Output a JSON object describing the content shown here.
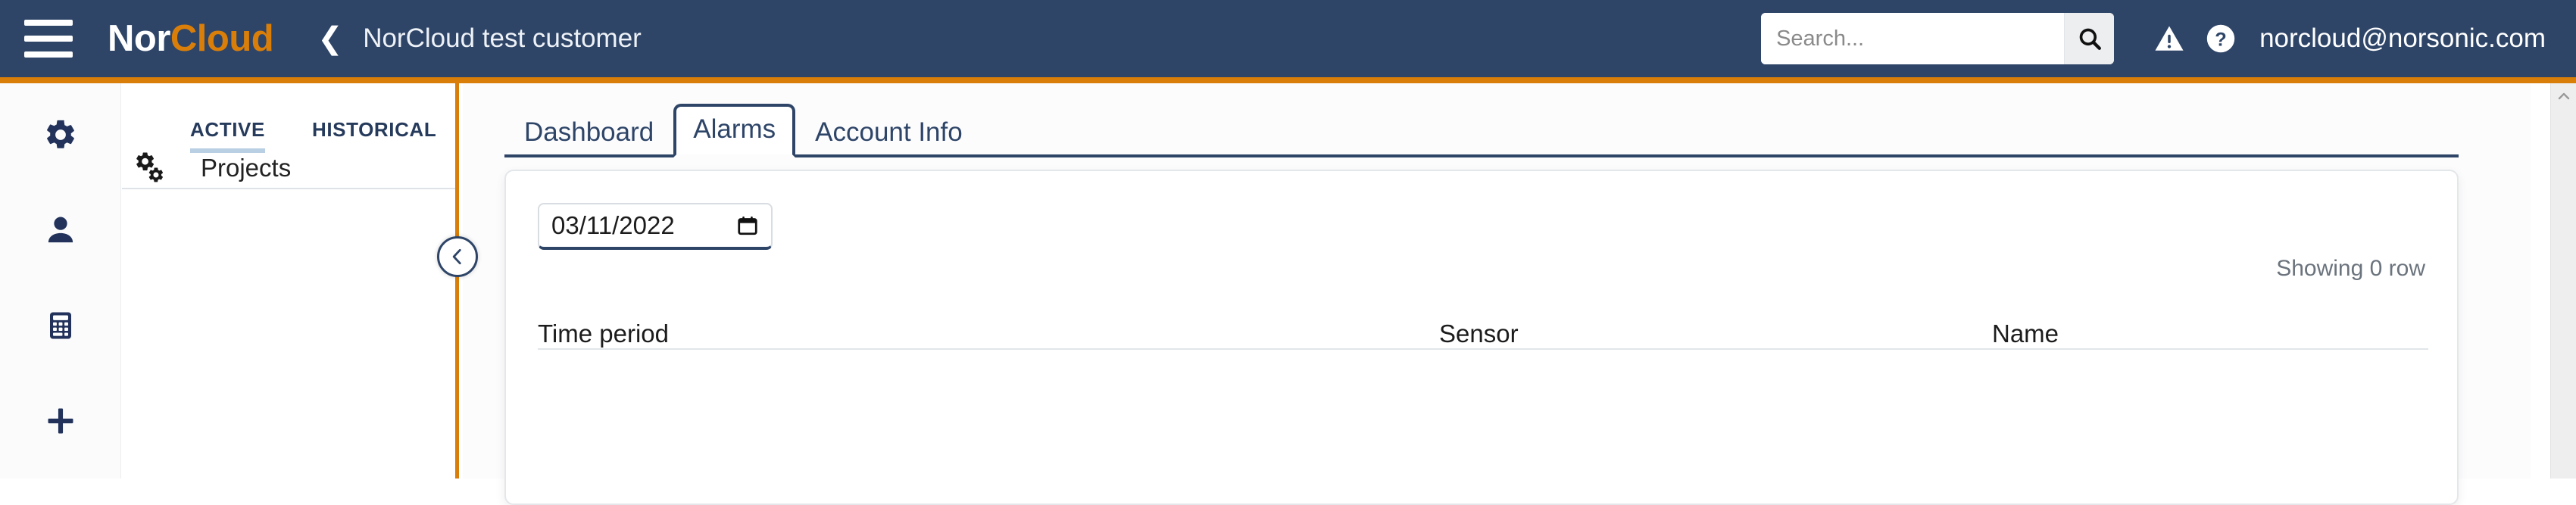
{
  "header": {
    "hamburger_icon": "hamburger-menu-icon",
    "brand_nor": "Nor",
    "brand_cloud": "Cloud",
    "back_icon": "chevron-left-icon",
    "breadcrumb_title": "NorCloud test customer",
    "search_placeholder": "Search...",
    "search_value": "",
    "search_icon": "search-icon",
    "warning_icon": "warning-triangle-icon",
    "help_icon": "question-circle-icon",
    "user_email": "norcloud@norsonic.com",
    "background_color": "#2e4568",
    "accent_color": "#d97e09"
  },
  "rail": {
    "items": [
      {
        "name": "settings",
        "icon": "gear-icon"
      },
      {
        "name": "users",
        "icon": "person-icon"
      },
      {
        "name": "calculator",
        "icon": "calculator-icon"
      },
      {
        "name": "add",
        "icon": "plus-icon"
      }
    ]
  },
  "projects_panel": {
    "tabs": [
      {
        "label": "ACTIVE",
        "active": true
      },
      {
        "label": "HISTORICAL",
        "active": false
      }
    ],
    "group_icon": "cogs-icon",
    "group_label": "Projects",
    "collapse_icon": "chevron-left-icon",
    "divider_color": "#d97e09",
    "active_tab_underline_color": "#b9cfe4"
  },
  "main": {
    "tabs": [
      {
        "label": "Dashboard",
        "active": false
      },
      {
        "label": "Alarms",
        "active": true
      },
      {
        "label": "Account Info",
        "active": false
      }
    ],
    "date_filter": {
      "value": "03/11/2022",
      "icon": "calendar-icon"
    },
    "showing_rows": "Showing 0 row",
    "table": {
      "columns": [
        "Time period",
        "Sensor",
        "Name"
      ],
      "rows": []
    }
  },
  "scrollbar": {
    "up_arrow_icon": "chevron-up-icon"
  }
}
